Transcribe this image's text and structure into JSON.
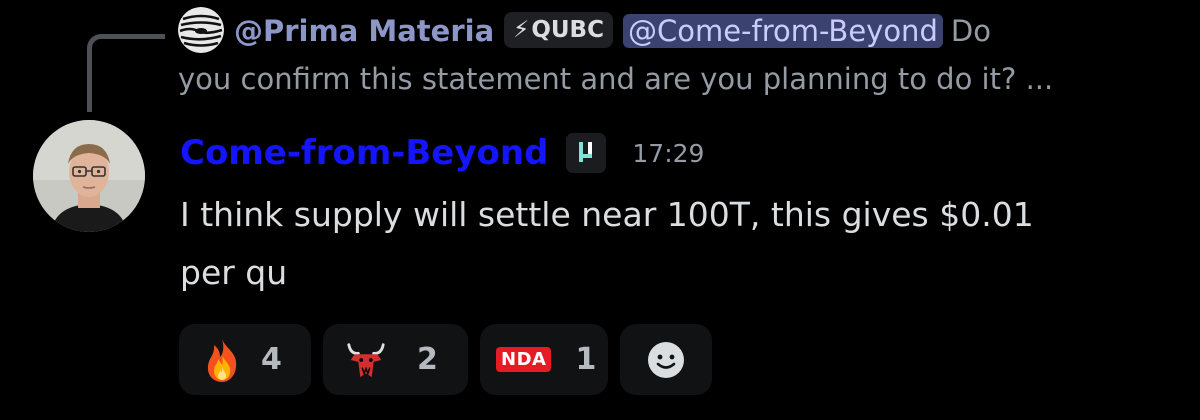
{
  "reply": {
    "author": "@Prima Materia",
    "tag": "QUBC",
    "mention": "@Come-from-Beyond",
    "text_line1": "Do",
    "text_line2": "you confirm this statement and are you planning to do it? ..."
  },
  "message": {
    "author": "Come-from-Beyond",
    "time": "17:29",
    "body_line1": "I think supply will settle near 100T, this gives $0.01",
    "body_line2": "per qu"
  },
  "reactions": [
    {
      "emoji": "fire-icon",
      "count": "4"
    },
    {
      "emoji": "bull-icon",
      "count": "2"
    },
    {
      "emoji": "nda-icon",
      "label": "NDA",
      "count": "1"
    }
  ],
  "colors": {
    "background": "#000000",
    "author": "#1414ff",
    "mention_bg": "#3c4270",
    "reply_author": "#8d96c8"
  }
}
